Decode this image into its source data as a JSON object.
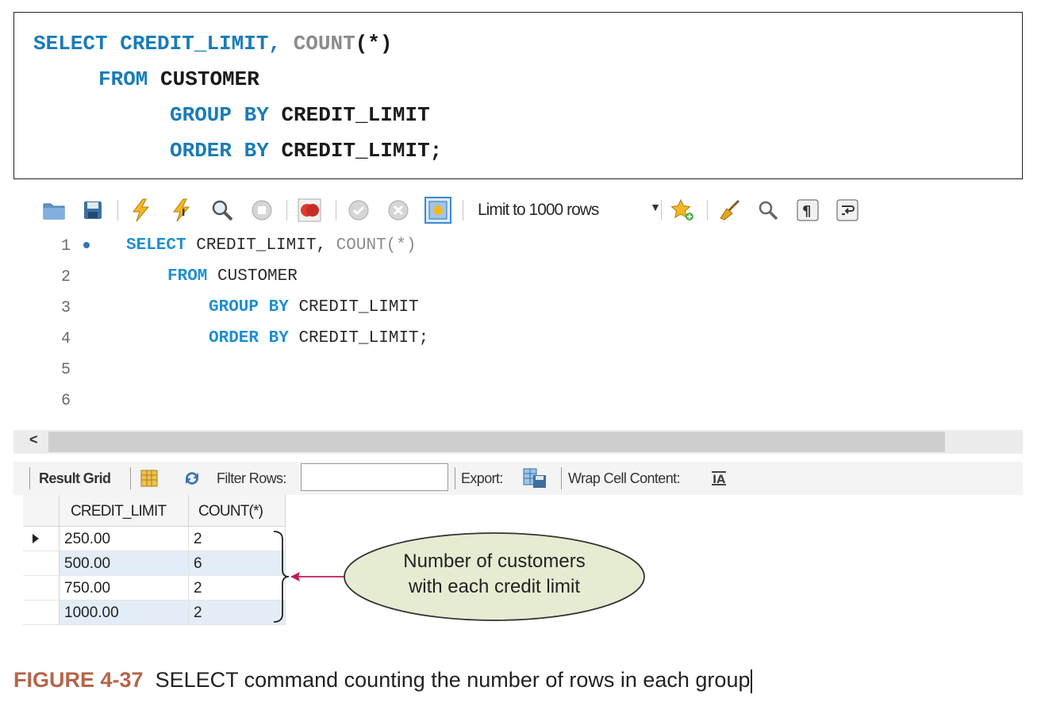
{
  "code_box": {
    "line1": {
      "kw1": "SELECT",
      "t1": "CREDIT_LIMIT,",
      "fn": "COUNT",
      "t2": "(*)"
    },
    "line2": {
      "kw1": "FROM",
      "t1": "CUSTOMER"
    },
    "line3": {
      "kw1": "GROUP BY",
      "t1": "CREDIT_LIMIT"
    },
    "line4": {
      "kw1": "ORDER BY",
      "t1": "CREDIT_LIMIT;"
    }
  },
  "toolbar": {
    "limit_label": "Limit to 1000 rows"
  },
  "editor": {
    "line_numbers": [
      "1",
      "2",
      "3",
      "4",
      "5",
      "6"
    ],
    "line1": {
      "kw1": "SELECT",
      "t1": "CREDIT_LIMIT,",
      "fn": "COUNT(*)"
    },
    "line2": {
      "kw1": "FROM",
      "t1": "CUSTOMER"
    },
    "line3": {
      "kw1": "GROUP BY",
      "t1": "CREDIT_LIMIT"
    },
    "line4": {
      "kw1": "ORDER BY",
      "t1": "CREDIT_LIMIT;"
    },
    "scroll_left": "<"
  },
  "result_bar": {
    "result_grid": "Result Grid",
    "filter_rows": "Filter Rows:",
    "export": "Export:",
    "wrap": "Wrap Cell Content:"
  },
  "grid": {
    "columns": [
      "CREDIT_LIMIT",
      "COUNT(*)"
    ],
    "rows": [
      [
        "250.00",
        "2"
      ],
      [
        "500.00",
        "6"
      ],
      [
        "750.00",
        "2"
      ],
      [
        "1000.00",
        "2"
      ]
    ]
  },
  "callout": {
    "line1": "Number of customers",
    "line2": "with each credit limit"
  },
  "caption": {
    "label": "FIGURE 4-37",
    "text": "SELECT command counting the number of rows in each group"
  }
}
